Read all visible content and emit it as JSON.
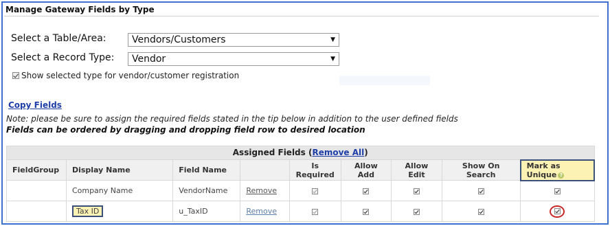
{
  "panel": {
    "title": "Manage Gateway Fields by Type"
  },
  "form": {
    "table_area_label": "Select a Table/Area:",
    "table_area_value": "Vendors/Customers",
    "record_type_label": "Select a Record Type:",
    "record_type_value": "Vendor",
    "show_selected_label": "Show selected type for vendor/customer registration"
  },
  "links": {
    "copy_fields": "Copy Fields"
  },
  "notes": {
    "note1": "Note: please be sure to assign the required fields stated in the tip below in addition to the user defined fields",
    "note2": "Fields can be ordered by dragging and dropping field row to desired location"
  },
  "table": {
    "caption": "Assigned Fields (",
    "remove_all": "Remove All",
    "caption_close": ")",
    "headers": [
      "FieldGroup",
      "Display Name",
      "Field Name",
      "",
      "Is Required",
      "Allow Add",
      "Allow Edit",
      "Show On Search",
      "Mark as Unique"
    ],
    "rows": [
      {
        "group": "",
        "display": "Company Name",
        "field": "VendorName",
        "remove": "Remove"
      },
      {
        "group": "",
        "display": "Tax ID",
        "field": "u_TaxID",
        "remove": "Remove"
      }
    ]
  },
  "colors": {
    "frame": "#3f6fcf",
    "highlight": "#fbf2b4",
    "circle": "#c62828",
    "link": "#1f3fa8"
  }
}
